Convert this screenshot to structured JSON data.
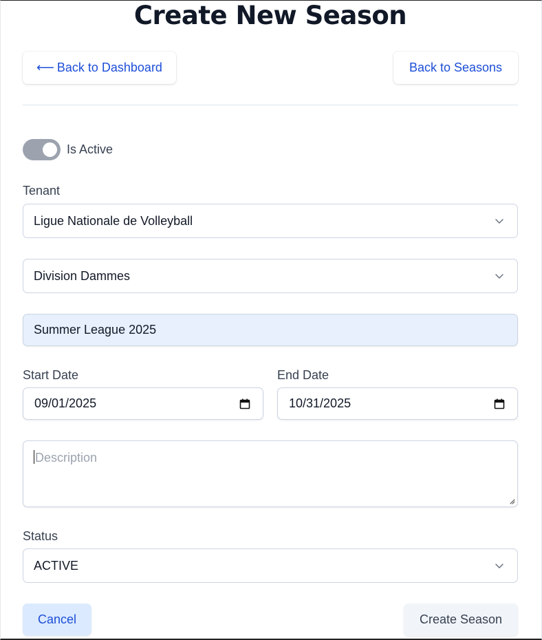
{
  "page": {
    "title": "Create New Season"
  },
  "nav": {
    "back_dashboard_arrow": "⟵",
    "back_dashboard_label": "Back to Dashboard",
    "back_seasons_label": "Back to Seasons"
  },
  "active_toggle": {
    "label": "Is Active",
    "on": true
  },
  "tenant": {
    "label": "Tenant",
    "value": "Ligue Nationale de Volleyball"
  },
  "division": {
    "value": "Division Dammes"
  },
  "season_name": {
    "value": "Summer League 2025"
  },
  "start_date": {
    "label": "Start Date",
    "value": "09/01/2025"
  },
  "end_date": {
    "label": "End Date",
    "value": "10/31/2025"
  },
  "description": {
    "placeholder": "Description",
    "value": ""
  },
  "status": {
    "label": "Status",
    "value": "ACTIVE"
  },
  "actions": {
    "cancel_label": "Cancel",
    "create_label": "Create Season"
  },
  "colors": {
    "accent": "#1d4ed8",
    "toggle_track": "#9ca3af",
    "autofill_bg": "#e8f0fe",
    "cancel_bg": "#dbeafe"
  },
  "icons": {
    "select": "chevron-down-icon",
    "date": "calendar-icon"
  }
}
